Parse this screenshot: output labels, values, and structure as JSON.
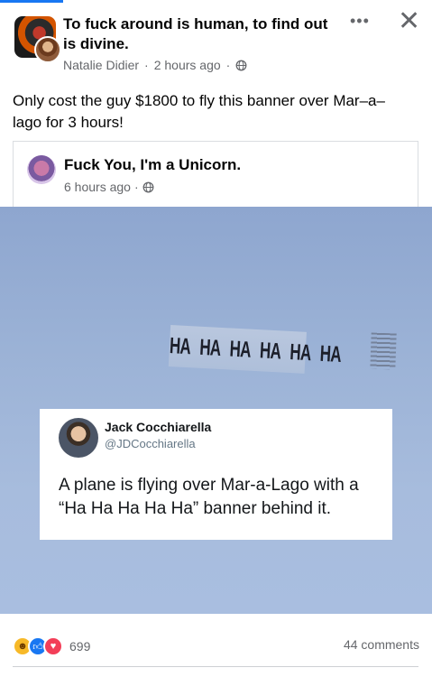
{
  "post": {
    "title": "To fuck around is human, to find out is divine.",
    "author": "Natalie Didier",
    "time": "2 hours ago",
    "text": "Only cost the guy $1800 to fly this banner over Mar–a–lago for 3 hours!"
  },
  "shared": {
    "page_name": "Fuck You, I'm a Unicorn.",
    "time": "6 hours ago"
  },
  "photo": {
    "banner_text": "HA HA HA HA HA HA",
    "tweet": {
      "name": "Jack Cocchiarella",
      "handle": "@JDCocchiarella",
      "text": "A plane is flying over Mar-a-Lago with a “Ha Ha Ha Ha Ha” banner behind it."
    }
  },
  "footer": {
    "reaction_count": "699",
    "comments": "44 comments"
  },
  "icons": {
    "more": "more-options-icon",
    "close": "close-icon",
    "privacy": "globe-icon",
    "reactions": [
      "haha-icon",
      "like-icon",
      "love-icon"
    ]
  },
  "colors": {
    "accent": "#1877f2",
    "secondary_text": "#65676b",
    "sky": "#9bb2d6"
  }
}
